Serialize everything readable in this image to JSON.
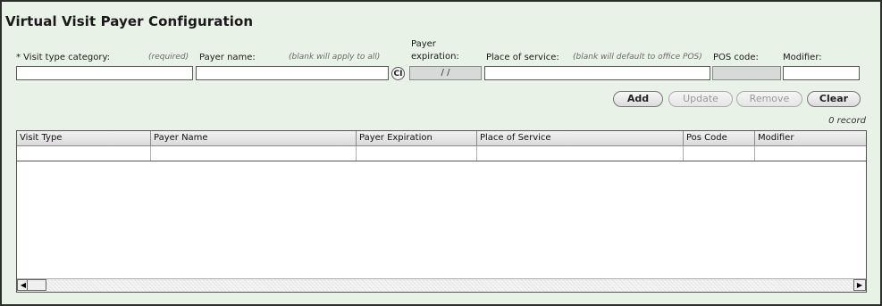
{
  "title": "Virtual Visit Payer Configuration",
  "form": {
    "visit_type": {
      "label": "* Visit type category:",
      "hint": "(required)",
      "value": ""
    },
    "payer_name": {
      "label": "Payer name:",
      "hint": "(blank will apply to all)",
      "value": ""
    },
    "ci_button": "CI",
    "payer_expiration": {
      "label_line1": "Payer",
      "label_line2": "expiration:",
      "value": "/ /"
    },
    "place_of_service": {
      "label": "Place of service:",
      "hint": "(blank will default to office POS)",
      "value": ""
    },
    "pos_code": {
      "label": "POS code:",
      "value": ""
    },
    "modifier": {
      "label": "Modifier:",
      "value": ""
    }
  },
  "buttons": {
    "add": "Add",
    "update": "Update",
    "remove": "Remove",
    "clear": "Clear"
  },
  "record_count": "0 record",
  "table": {
    "columns": [
      "Visit Type",
      "Payer Name",
      "Payer Expiration",
      "Place of Service",
      "Pos Code",
      "Modifier"
    ]
  },
  "scroll": {
    "left_icon": "scroll-left-arrow-icon",
    "right_icon": "scroll-right-arrow-icon"
  }
}
